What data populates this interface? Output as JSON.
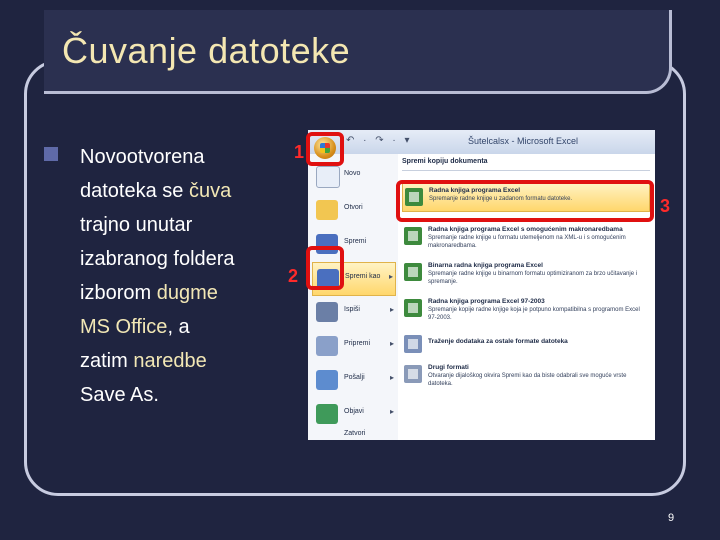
{
  "slide": {
    "title": "Čuvanje datoteke",
    "page_number": "9",
    "body_lines": [
      {
        "plain": "Novootvorena",
        "hl": ""
      },
      {
        "plain": "datoteka se ",
        "hl": "čuva"
      },
      {
        "plain": "trajno unutar",
        "hl": ""
      },
      {
        "plain": "izabranog foldera",
        "hl": ""
      },
      {
        "plain": "izborom ",
        "hl": "dugme"
      },
      {
        "plain": "MS Office",
        "hl": ", a"
      },
      {
        "plain": "zatim ",
        "hl": "naredbe"
      },
      {
        "plain": "Save As.",
        "hl": ""
      }
    ],
    "markers": {
      "one": "1",
      "two": "2",
      "three": "3"
    }
  },
  "screenshot": {
    "window_title": "Šutelcalsx - Microsoft Excel",
    "qat": "↶ · ↷ · ▾",
    "menu_items": [
      {
        "label": "Novo",
        "color": "#e8eef8",
        "arrow": ""
      },
      {
        "label": "Otvori",
        "color": "#f2c651",
        "arrow": ""
      },
      {
        "label": "Spremi",
        "color": "#4a6fbf",
        "arrow": ""
      },
      {
        "label": "Spremi kao",
        "color": "#4a6fbf",
        "arrow": "▸"
      },
      {
        "label": "Ispiši",
        "color": "#6b7fa6",
        "arrow": "▸"
      },
      {
        "label": "Pripremi",
        "color": "#8aa0c9",
        "arrow": "▸"
      },
      {
        "label": "Pošalji",
        "color": "#5d8ccf",
        "arrow": "▸"
      },
      {
        "label": "Objavi",
        "color": "#3f9a5a",
        "arrow": "▸"
      },
      {
        "label": "Zatvori",
        "color": "#dfe6f2",
        "arrow": ""
      }
    ],
    "panel_heading": "Spremi kopiju dokumenta",
    "sub_items": [
      {
        "title": "Radna knjiga programa Excel",
        "desc": "Spremanje radne knjige u zadanom formatu datoteke."
      },
      {
        "title": "Radna knjiga programa Excel s omogućenim makronaredbama",
        "desc": "Spremanje radne knjige u formatu utemeljenom na XML-u i s omogućenim makronaredbama."
      },
      {
        "title": "Binarna radna knjiga programa Excel",
        "desc": "Spremanje radne knjige u binarnom formatu optimiziranom za brzo učitavanje i spremanje."
      },
      {
        "title": "Radna knjiga programa Excel 97-2003",
        "desc": "Spremanje kopije radne knjige koja je potpuno kompatibilna s programom Excel 97-2003."
      },
      {
        "title": "Traženje dodataka za ostale formate datoteka",
        "desc": ""
      },
      {
        "title": "Drugi formati",
        "desc": "Otvaranje dijaloškog okvira Spremi kao da biste odabrali sve moguće vrste datoteka."
      }
    ]
  }
}
